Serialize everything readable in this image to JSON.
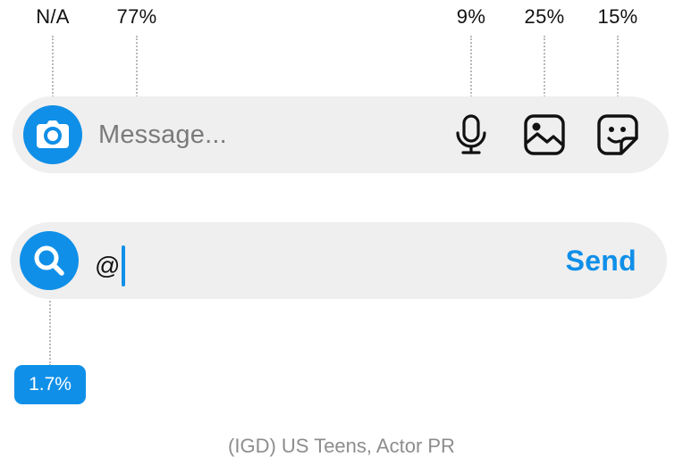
{
  "stats": {
    "camera": "N/A",
    "message_field": "77%",
    "mic": "9%",
    "gallery": "25%",
    "sticker": "15%",
    "search": "1.7%"
  },
  "message_bar": {
    "placeholder": "Message...",
    "icons": [
      "camera-icon",
      "microphone-icon",
      "gallery-icon",
      "sticker-icon"
    ]
  },
  "search_bar": {
    "typed_text": "@",
    "send_label": "Send",
    "icon": "search-icon"
  },
  "footer": {
    "caption": "(IGD) US Teens, Actor PR"
  },
  "colors": {
    "accent": "#0f8fe8",
    "bar_background": "#efefef",
    "placeholder": "#7a7a7a",
    "caption": "#8d8d8d"
  }
}
